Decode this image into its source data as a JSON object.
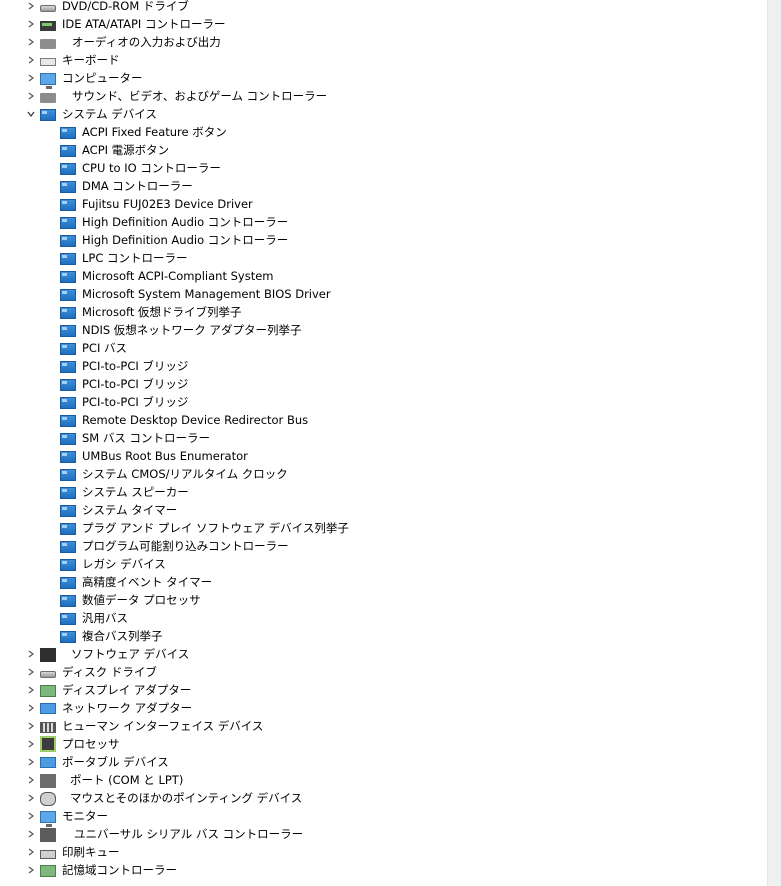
{
  "tree": {
    "top_categories": [
      {
        "label": "DVD/CD-ROM ドライブ",
        "icon": "dvd-drive-icon",
        "expanded": false
      },
      {
        "label": "IDE ATA/ATAPI コントローラー",
        "icon": "ide-controller-icon",
        "expanded": false
      },
      {
        "label": "オーディオの入力および出力",
        "icon": "audio-io-icon",
        "expanded": false
      },
      {
        "label": "キーボード",
        "icon": "keyboard-icon",
        "expanded": false
      },
      {
        "label": "コンピューター",
        "icon": "computer-icon",
        "expanded": false
      },
      {
        "label": "サウンド、ビデオ、およびゲーム コントローラー",
        "icon": "sound-video-icon",
        "expanded": false
      },
      {
        "label": "システム デバイス",
        "icon": "system-devices-icon",
        "expanded": true
      }
    ],
    "system_devices": [
      "ACPI Fixed Feature ボタン",
      "ACPI 電源ボタン",
      "CPU to IO コントローラー",
      "DMA コントローラー",
      "Fujitsu FUJ02E3 Device Driver",
      "High Definition Audio コントローラー",
      "High Definition Audio コントローラー",
      "LPC コントローラー",
      "Microsoft ACPI-Compliant System",
      "Microsoft System Management BIOS Driver",
      "Microsoft 仮想ドライブ列挙子",
      "NDIS 仮想ネットワーク アダプター列挙子",
      "PCI バス",
      "PCI-to-PCI ブリッジ",
      "PCI-to-PCI ブリッジ",
      "PCI-to-PCI ブリッジ",
      "Remote Desktop Device Redirector Bus",
      "SM バス コントローラー",
      "UMBus Root Bus Enumerator",
      "システム CMOS/リアルタイム クロック",
      "システム スピーカー",
      "システム タイマー",
      "プラグ アンド プレイ ソフトウェア デバイス列挙子",
      "プログラム可能割り込みコントローラー",
      "レガシ デバイス",
      "高精度イベント タイマー",
      "数値データ プロセッサ",
      "汎用バス",
      "複合バス列挙子"
    ],
    "bottom_categories": [
      {
        "label": "ソフトウェア デバイス",
        "icon": "software-device-icon"
      },
      {
        "label": "ディスク ドライブ",
        "icon": "disk-drive-icon"
      },
      {
        "label": "ディスプレイ アダプター",
        "icon": "display-adapter-icon"
      },
      {
        "label": "ネットワーク アダプター",
        "icon": "network-adapter-icon"
      },
      {
        "label": "ヒューマン インターフェイス デバイス",
        "icon": "hid-icon"
      },
      {
        "label": "プロセッサ",
        "icon": "processor-icon"
      },
      {
        "label": "ポータブル デバイス",
        "icon": "portable-device-icon"
      },
      {
        "label": "ポート (COM と LPT)",
        "icon": "port-icon"
      },
      {
        "label": "マウスとそのほかのポインティング デバイス",
        "icon": "mouse-icon"
      },
      {
        "label": "モニター",
        "icon": "monitor-icon"
      },
      {
        "label": "ユニバーサル シリアル バス コントローラー",
        "icon": "usb-controller-icon"
      },
      {
        "label": "印刷キュー",
        "icon": "print-queue-icon"
      },
      {
        "label": "記憶域コントローラー",
        "icon": "storage-controller-icon"
      }
    ]
  }
}
